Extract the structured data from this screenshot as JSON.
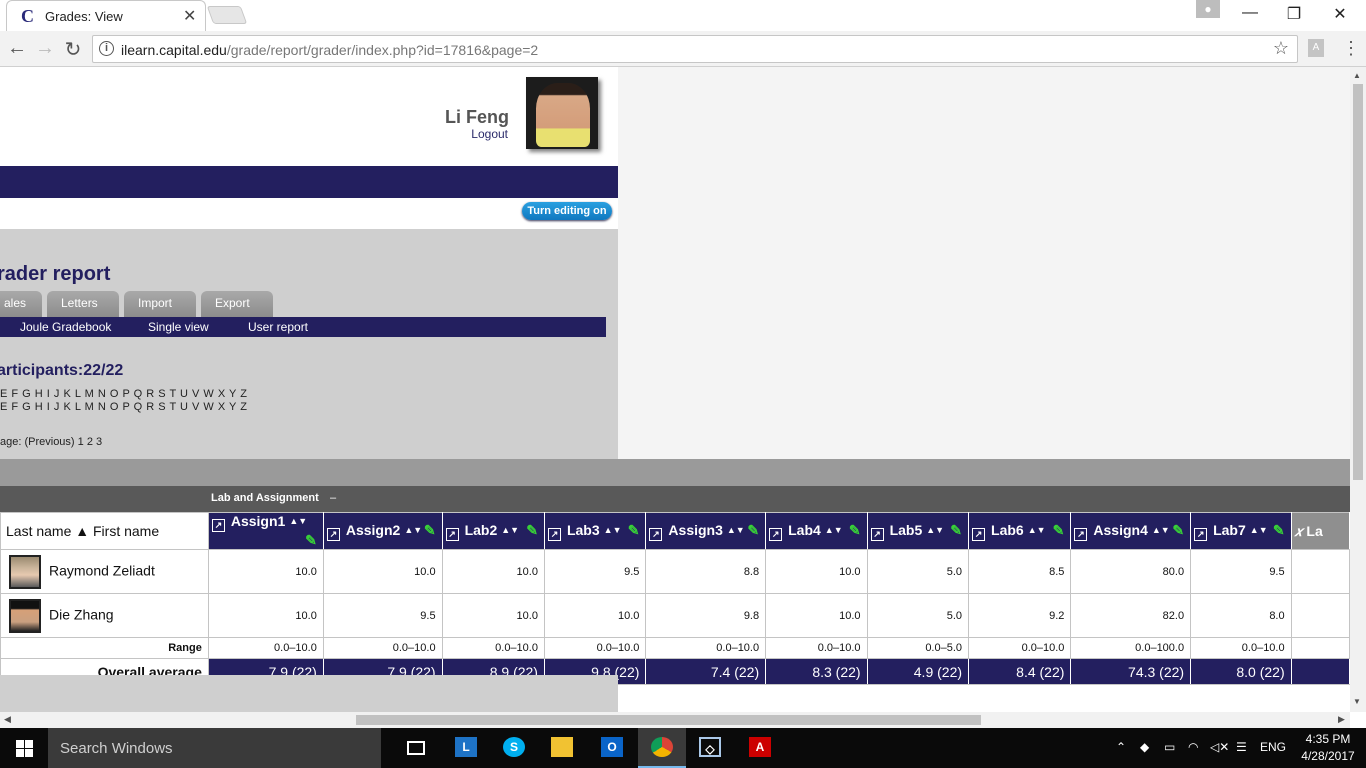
{
  "browser": {
    "tab_title": "Grades: View",
    "tab_favicon": "C",
    "url_host": "ilearn.capital.edu",
    "url_path": "/grade/report/grader/index.php?id=17816&page=2"
  },
  "header": {
    "user_name": "Li Feng",
    "logout_label": "Logout",
    "edit_button": "Turn editing on"
  },
  "report": {
    "heading": "rader report",
    "tabs": [
      {
        "label": "ales"
      },
      {
        "label": "Letters"
      },
      {
        "label": "Import"
      },
      {
        "label": "Export"
      }
    ],
    "subnav": [
      {
        "label": "Joule Gradebook"
      },
      {
        "label": "Single view"
      },
      {
        "label": "User report"
      }
    ],
    "participants": "articipants:22/22",
    "alpha_first": "E F G H I J K L M N O P Q R S T U V W X Y Z",
    "alpha_last": "E F G H I J K L M N O P Q R S T U V W X Y Z",
    "pager": "age: (Previous) 1 2 3",
    "category": "Lab and Assignment",
    "category_toggle": "–"
  },
  "grades": {
    "name_header": "Last name ▲  First name",
    "columns": [
      "Assign1",
      "Assign2",
      "Lab2",
      "Lab3",
      "Assign3",
      "Lab4",
      "Lab5",
      "Lab6",
      "Assign4",
      "Lab7",
      "La"
    ],
    "students": [
      {
        "name": "Raymond Zeliadt",
        "grades": [
          "10.0",
          "10.0",
          "10.0",
          "9.5",
          "8.8",
          "10.0",
          "5.0",
          "8.5",
          "80.0",
          "9.5"
        ]
      },
      {
        "name": "Die Zhang",
        "grades": [
          "10.0",
          "9.5",
          "10.0",
          "10.0",
          "9.8",
          "10.0",
          "5.0",
          "9.2",
          "82.0",
          "8.0"
        ]
      }
    ],
    "range_label": "Range",
    "ranges": [
      "0.0–10.0",
      "0.0–10.0",
      "0.0–10.0",
      "0.0–10.0",
      "0.0–10.0",
      "0.0–10.0",
      "0.0–5.0",
      "0.0–10.0",
      "0.0–100.0",
      "0.0–10.0"
    ],
    "average_label": "Overall average",
    "averages": [
      "7.9 (22)",
      "7.9 (22)",
      "8.9 (22)",
      "9.8 (22)",
      "7.4 (22)",
      "8.3 (22)",
      "4.9 (22)",
      "8.4 (22)",
      "74.3 (22)",
      "8.0 (22)"
    ]
  },
  "taskbar": {
    "search_placeholder": "Search Windows",
    "language": "ENG",
    "time": "4:35 PM",
    "date": "4/28/2017"
  }
}
